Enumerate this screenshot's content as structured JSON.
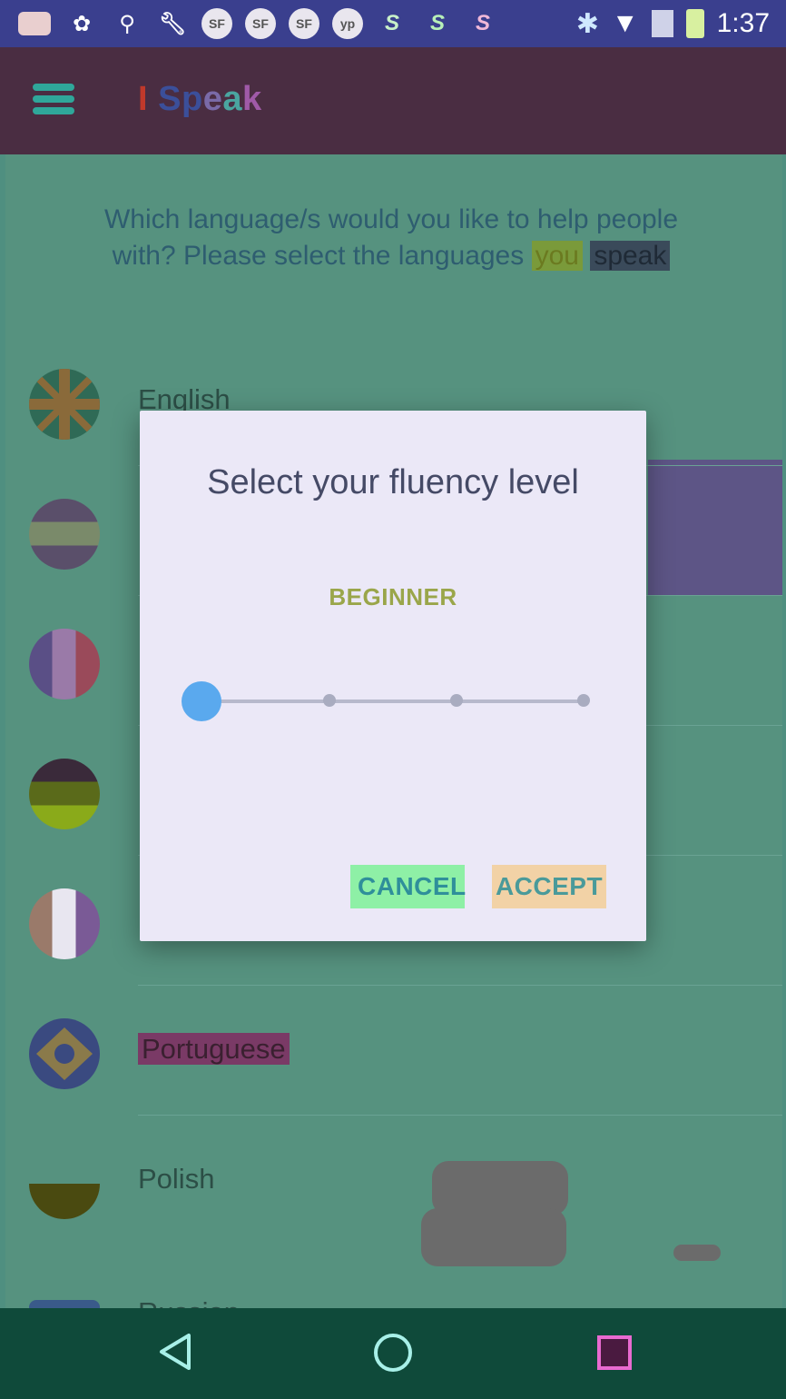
{
  "status_bar": {
    "time": "1:37",
    "left_icons": [
      "chat-icon",
      "cat-icon",
      "bike-icon",
      "wrench-icon",
      "sf-icon",
      "sf-icon",
      "sf-icon",
      "yelp-icon",
      "s-icon",
      "s-icon",
      "s-icon"
    ],
    "right_icons": [
      "bluetooth-icon",
      "wifi-icon",
      "signal-icon",
      "battery-icon"
    ]
  },
  "app_bar": {
    "title_parts": [
      "I ",
      "Sp",
      "e",
      "a",
      "k"
    ]
  },
  "prompt": {
    "text": "Which language/s would you like to help people with? Please select the languages",
    "you": "you",
    "speak": "speak"
  },
  "languages": [
    {
      "label": "English",
      "flag": "uk-flag-icon"
    },
    {
      "label": "",
      "flag": "flag-icon"
    },
    {
      "label": "",
      "flag": "flag-icon"
    },
    {
      "label": "",
      "flag": "flag-icon"
    },
    {
      "label": "",
      "flag": "flag-icon"
    },
    {
      "label": "Portuguese",
      "flag": "brazil-flag-icon"
    },
    {
      "label": "Polish",
      "flag": "poland-flag-icon"
    },
    {
      "label": "Russian",
      "flag": "russia-flag-icon"
    }
  ],
  "dialog": {
    "title": "Select your fluency level",
    "level": "BEGINNER",
    "slider_value": 0,
    "slider_steps": 4,
    "cancel_label": "CANCEL",
    "accept_label": "ACCEPT"
  },
  "colors": {
    "accent": "#5aa9ee",
    "status_bar": "#3a3f8e",
    "app_bar": "#4a2d42",
    "nav_bar": "#0f4a3a"
  },
  "nav": {
    "back": "back-icon",
    "home": "home-icon",
    "recents": "recents-icon"
  }
}
